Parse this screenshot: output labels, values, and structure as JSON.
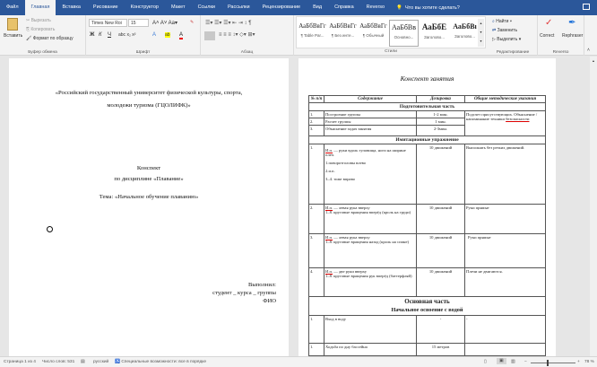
{
  "tabs": [
    "Файл",
    "Главная",
    "Вставка",
    "Рисование",
    "Конструктор",
    "Макет",
    "Ссылки",
    "Рассылки",
    "Рецензирование",
    "Вид",
    "Справка",
    "Reverso"
  ],
  "tell_me": "Что вы хотите сделать?",
  "clipboard": {
    "paste": "Вставить",
    "cut": "Вырезать",
    "copy": "Копировать",
    "format": "Формат по образцу",
    "label": "Буфер обмена"
  },
  "font": {
    "name": "Times New Roi",
    "size": "15",
    "label": "Шрифт",
    "bold": "Ж",
    "italic": "К",
    "underline": "Ч"
  },
  "paragraph": {
    "label": "Абзац"
  },
  "styles": {
    "label": "Стили",
    "items": [
      {
        "sample": "АаБбВвГг",
        "name": "¶ Table Par..."
      },
      {
        "sample": "АаБбВвГг",
        "name": "¶ Без инте..."
      },
      {
        "sample": "АаБбВвГг",
        "name": "¶ Обычный"
      },
      {
        "sample": "АаБбВв",
        "name": "Основно..."
      },
      {
        "sample": "АаБбЕ",
        "name": "Заголово..."
      },
      {
        "sample": "АаБбВı",
        "name": "Заголово..."
      }
    ]
  },
  "editing": {
    "find": "Найти",
    "replace": "Заменить",
    "select": "Выделить",
    "label": "Редактирование"
  },
  "reverso": {
    "correct": "Correct",
    "rephraser": "Rephraser",
    "label": "Reverso"
  },
  "left_page": {
    "university": "«Российский государственный университет физической культуры, спорта,",
    "university2": "молодежи туризма (ГЦОЛИФК)»",
    "title": "Конспект",
    "discipline": "по дисциплине  «Плавание»",
    "theme": "Тема: «Начальное обучение плаванию»",
    "done": "Выполнил:",
    "student": "студент _ курса _ группы",
    "fio": "ФИО"
  },
  "right_page": {
    "title": "Конспект занятия",
    "headers": [
      "№ п/п",
      "Содержание",
      "Дозировка",
      "Общие методические указания"
    ],
    "sec1": "Подготовительная часть",
    "prep": [
      [
        "1.",
        "Построение группы",
        "1-2 мин."
      ],
      [
        "2.",
        "Расчет группы",
        "1 мин."
      ],
      [
        "3.",
        "Объяснение задач занятия",
        "2-3мин."
      ]
    ],
    "prep_note": "Подсчет присутствующих. Объяснение / напоминание техники ",
    "prep_note_u": "безопасности",
    "sec2": "Имитационные упражнение",
    "imit": [
      {
        "n": "1.",
        "ip": "И.п.",
        "text": " — руки вдоль туловища, ноги на ширине плеч.",
        "lines": [
          "1.поворотголовы влево",
          "2.и.п.",
          "3–4. тоже вправо"
        ],
        "dose": "10 движений",
        "note": "Выполнять без резких движений."
      },
      {
        "n": "2.",
        "ip": "И.п.",
        "text": " — левая рука вверху",
        "lines": [
          "1–8. круговые вращения вперёд (кроль на груди)"
        ],
        "dose": "10 движений",
        "note": "Руки прямые"
      },
      {
        "n": "3.",
        "ip": "И.п.",
        "text": " — левая рука вверху",
        "lines": [
          "1–8. круговые вращения назад (кроль на спине)"
        ],
        "dose": "10 движений",
        "note": "Руки прямые"
      },
      {
        "n": "4.",
        "ip": "И.п.",
        "text": " — две руки вверху",
        "lines": [
          "1–8. круговые вращения рук вперёд (баттерфляй)"
        ],
        "dose": "10 движений",
        "note": "Плечи не двигаются."
      }
    ],
    "sec3": "Основная часть",
    "sec3b": "Начальное освоение с водой",
    "main": [
      [
        "1.",
        "Вход в воду",
        "-",
        "-"
      ],
      [
        "1.",
        "Ходьба по дну бассейна",
        "15 метров",
        ""
      ]
    ]
  },
  "status": {
    "page": "Страница 1 из 4",
    "words": "Число слов: 531",
    "lang": "русский",
    "access": "Специальные возможности: все в порядке",
    "zoom": "78 %"
  },
  "zoom_level": 78
}
